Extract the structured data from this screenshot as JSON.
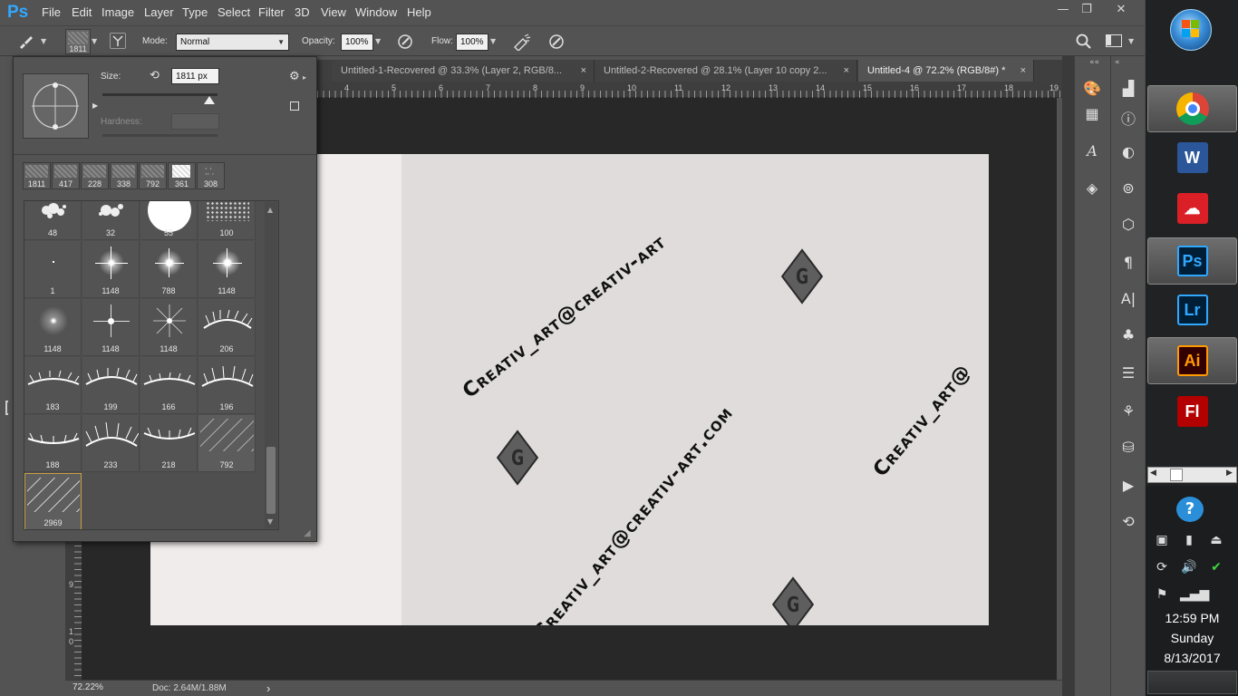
{
  "app": {
    "logo": "Ps"
  },
  "menu": [
    "File",
    "Edit",
    "Image",
    "Layer",
    "Type",
    "Select",
    "Filter",
    "3D",
    "View",
    "Window",
    "Help"
  ],
  "window_controls": {
    "minimize": "—",
    "restore": "❐",
    "close": "✕"
  },
  "options": {
    "brush_size": "1811",
    "mode_label": "Mode:",
    "mode_value": "Normal",
    "opacity_label": "Opacity:",
    "opacity_value": "100%",
    "flow_label": "Flow:",
    "flow_value": "100%"
  },
  "brush_panel": {
    "size_label": "Size:",
    "size_value": "1811 px",
    "hardness_label": "Hardness:",
    "presets": [
      {
        "label": "1811"
      },
      {
        "label": "417"
      },
      {
        "label": "228"
      },
      {
        "label": "338"
      },
      {
        "label": "792"
      },
      {
        "label": "361"
      },
      {
        "label": "308"
      }
    ],
    "brushes": [
      {
        "label": "48",
        "kind": "splatter"
      },
      {
        "label": "32",
        "kind": "splatter"
      },
      {
        "label": "55",
        "kind": "round-soft"
      },
      {
        "label": "100",
        "kind": "texture"
      },
      {
        "label": "1",
        "kind": "dot"
      },
      {
        "label": "1148",
        "kind": "sparkle"
      },
      {
        "label": "788",
        "kind": "sparkle"
      },
      {
        "label": "1148",
        "kind": "sparkle"
      },
      {
        "label": "1148",
        "kind": "glow"
      },
      {
        "label": "1148",
        "kind": "star"
      },
      {
        "label": "1148",
        "kind": "flare"
      },
      {
        "label": "206",
        "kind": "lash"
      },
      {
        "label": "183",
        "kind": "lash"
      },
      {
        "label": "199",
        "kind": "lash"
      },
      {
        "label": "166",
        "kind": "lash"
      },
      {
        "label": "196",
        "kind": "lash"
      },
      {
        "label": "188",
        "kind": "lash"
      },
      {
        "label": "233",
        "kind": "lash"
      },
      {
        "label": "218",
        "kind": "lash"
      },
      {
        "label": "792",
        "kind": "pattern"
      },
      {
        "label": "2969",
        "kind": "pattern",
        "selected": true
      }
    ]
  },
  "tabs": [
    {
      "label": "Untitled-1-Recovered @ 33.3% (Layer 2, RGB/8...",
      "close": "×"
    },
    {
      "label": "Untitled-2-Recovered @ 28.1% (Layer 10 copy 2...",
      "close": "×"
    },
    {
      "label": "Untitled-4 @ 72.2% (RGB/8#) *",
      "close": "×",
      "active": true
    }
  ],
  "ruler": {
    "h": [
      "4",
      "5",
      "6",
      "7",
      "8",
      "9",
      "10",
      "11",
      "12",
      "13",
      "14",
      "15",
      "16",
      "17",
      "18",
      "19"
    ],
    "v": [
      "9",
      "1\n0"
    ]
  },
  "canvas": {
    "watermark": [
      "Creativ_art@creativ-art",
      "Creativ_art@creativ-art.com",
      "Creativ_art@",
      "art@creativ-art.com"
    ],
    "gem_letter": "G"
  },
  "status": {
    "zoom": "72.22%",
    "doc": "Doc: 2.64M/1.88M",
    "arrow": "›"
  },
  "taskbar": {
    "time": "12:59 PM",
    "day": "Sunday",
    "date": "8/13/2017",
    "apps": [
      {
        "label": "W",
        "color": "#2b579a"
      },
      {
        "label": "Ps",
        "color": "#001e36",
        "fg": "#31a8ff"
      },
      {
        "label": "Lr",
        "color": "#001e36",
        "fg": "#31a8ff"
      },
      {
        "label": "Ai",
        "color": "#330000",
        "fg": "#ff9a00"
      },
      {
        "label": "Fl",
        "color": "#b30000",
        "fg": "#ffffff"
      }
    ],
    "expand": "▶"
  }
}
